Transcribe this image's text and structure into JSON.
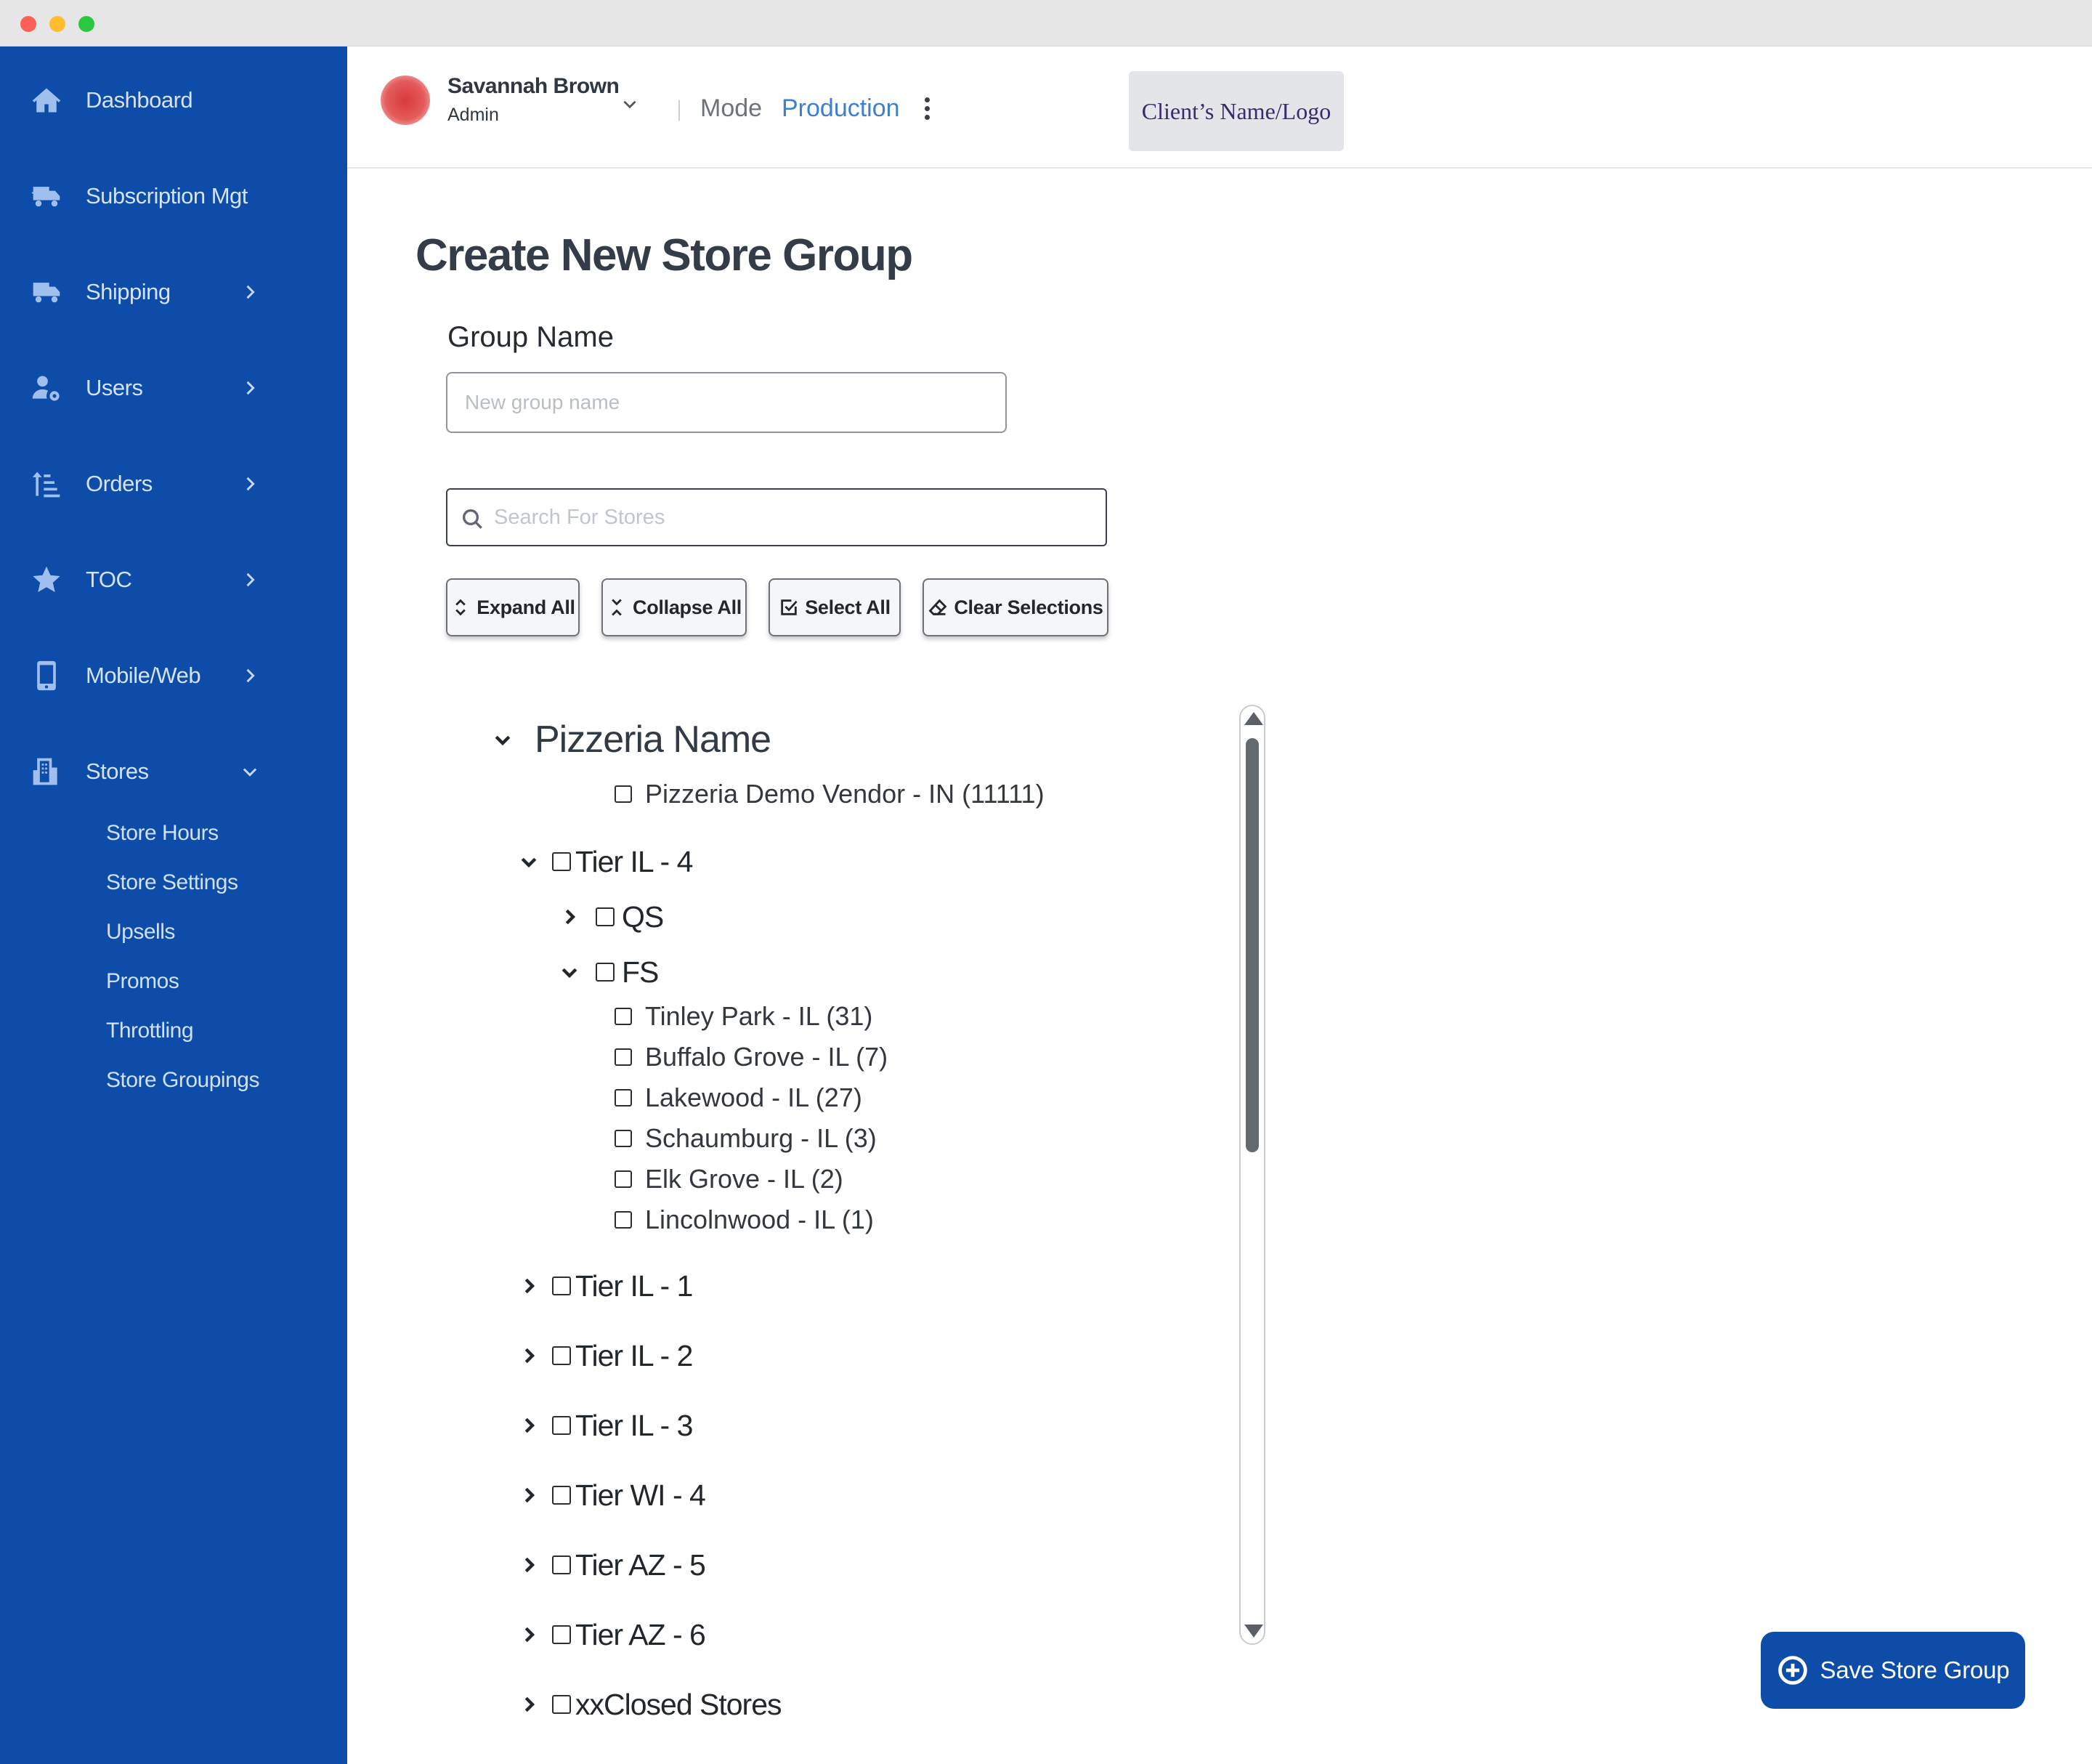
{
  "window": {
    "controls": [
      "close",
      "minimize",
      "zoom"
    ]
  },
  "colors": {
    "sidebar": "#0d4ca8",
    "accent": "#3f7fd0",
    "save_button": "#0d4ca8"
  },
  "sidebar": {
    "items": [
      {
        "label": "Dashboard",
        "icon": "home-icon",
        "has_chevron": false
      },
      {
        "label": "Subscription Mgt",
        "icon": "truck-icon",
        "has_chevron": false
      },
      {
        "label": "Shipping",
        "icon": "truck-icon",
        "has_chevron": true
      },
      {
        "label": "Users",
        "icon": "users-gear-icon",
        "has_chevron": true
      },
      {
        "label": "Orders",
        "icon": "sort-list-icon",
        "has_chevron": true
      },
      {
        "label": "TOC",
        "icon": "star-icon",
        "has_chevron": true
      },
      {
        "label": "Mobile/Web",
        "icon": "mobile-icon",
        "has_chevron": true
      },
      {
        "label": "Stores",
        "icon": "building-icon",
        "has_chevron": true,
        "expanded": true
      }
    ],
    "stores_sub": [
      "Store Hours",
      "Store Settings",
      "Upsells",
      "Promos",
      "Throttling",
      "Store Groupings"
    ]
  },
  "header": {
    "user_name": "Savannah Brown",
    "user_role": "Admin",
    "mode_label": "Mode",
    "mode_value": "Production",
    "client_logo": "Client’s Name/Logo"
  },
  "main": {
    "title": "Create New Store Group",
    "group_name_label": "Group Name",
    "group_name_placeholder": "New group name",
    "search_placeholder": "Search For Stores",
    "toolbar": {
      "expand_all": "Expand All",
      "collapse_all": "Collapse All",
      "select_all": "Select All",
      "clear_selections": "Clear Selections"
    },
    "tree": {
      "root": "Pizzeria Name",
      "vendor": "Pizzeria Demo Vendor - IN (11111)",
      "tier_il4": "Tier IL - 4",
      "qs": "QS",
      "fs": "FS",
      "fs_stores": [
        "Tinley Park - IL (31)",
        "Buffalo Grove - IL (7)",
        "Lakewood - IL (27)",
        "Schaumburg - IL (3)",
        "Elk Grove - IL (2)",
        "Lincolnwood - IL (1)"
      ],
      "other_tiers": [
        "Tier IL - 1",
        "Tier IL - 2",
        "Tier IL - 3",
        "Tier WI - 4",
        "Tier AZ - 5",
        "Tier AZ - 6",
        "xxClosed Stores"
      ]
    },
    "save_label": "Save Store Group"
  }
}
